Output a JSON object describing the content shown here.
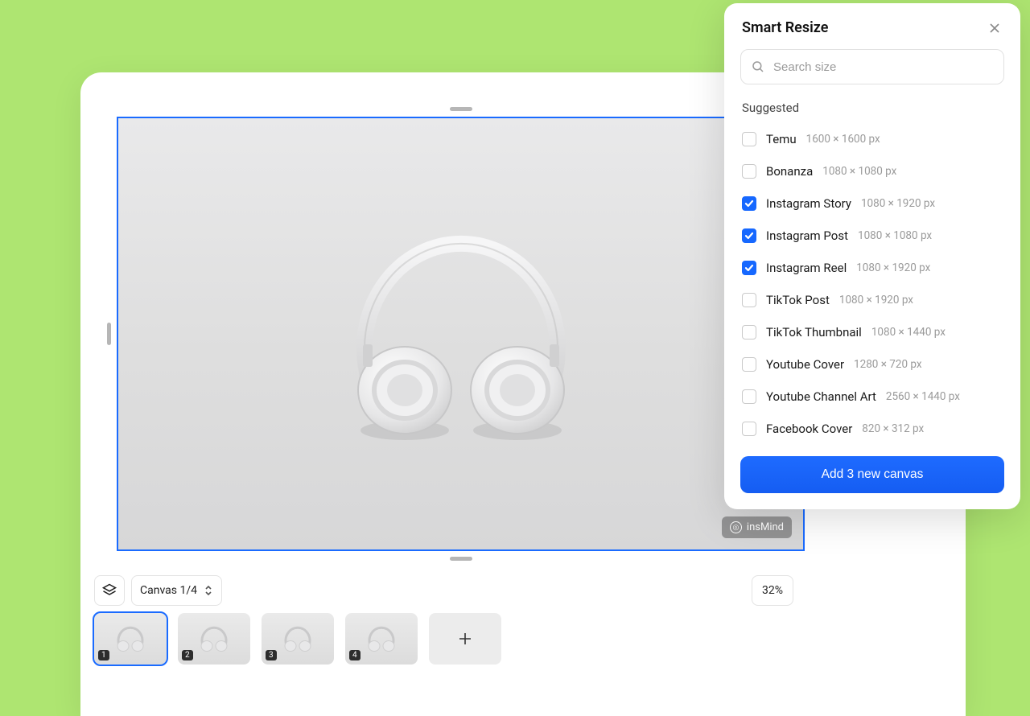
{
  "watermark": "insMind",
  "canvasSelector": "Canvas 1/4",
  "zoom": "32%",
  "thumbs": [
    {
      "n": "1",
      "active": true
    },
    {
      "n": "2",
      "active": false
    },
    {
      "n": "3",
      "active": false
    },
    {
      "n": "4",
      "active": false
    }
  ],
  "panel": {
    "title": "Smart Resize",
    "searchPlaceholder": "Search size",
    "section": "Suggested",
    "sizes": [
      {
        "name": "Temu",
        "dim": "1600 × 1600 px",
        "checked": false
      },
      {
        "name": "Bonanza",
        "dim": "1080 × 1080 px",
        "checked": false
      },
      {
        "name": "Instagram Story",
        "dim": "1080 × 1920 px",
        "checked": true
      },
      {
        "name": "Instagram Post",
        "dim": "1080 × 1080 px",
        "checked": true
      },
      {
        "name": "Instagram Reel",
        "dim": "1080 × 1920 px",
        "checked": true
      },
      {
        "name": "TikTok Post",
        "dim": "1080 × 1920 px",
        "checked": false
      },
      {
        "name": "TikTok Thumbnail",
        "dim": "1080 × 1440 px",
        "checked": false
      },
      {
        "name": "Youtube Cover",
        "dim": "1280 × 720 px",
        "checked": false
      },
      {
        "name": "Youtube Channel Art",
        "dim": "2560 × 1440 px",
        "checked": false
      },
      {
        "name": "Facebook Cover",
        "dim": "820 × 312 px",
        "checked": false
      }
    ],
    "cta": "Add 3 new canvas"
  }
}
